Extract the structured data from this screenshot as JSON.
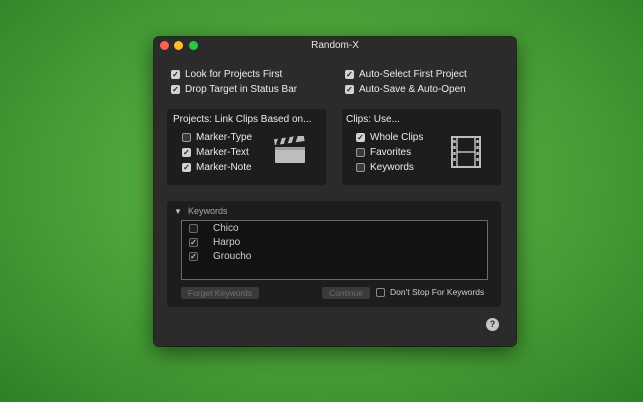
{
  "window": {
    "title": "Random-X"
  },
  "options": {
    "look_for_projects_first": {
      "label": "Look for Projects First",
      "checked": true
    },
    "drop_target_status_bar": {
      "label": "Drop Target in Status Bar",
      "checked": true
    },
    "auto_select_first_project": {
      "label": "Auto-Select First Project",
      "checked": true
    },
    "auto_save_auto_open": {
      "label": "Auto-Save & Auto-Open",
      "checked": true
    }
  },
  "projects_panel": {
    "title": "Projects: Link Clips Based on...",
    "items": [
      {
        "label": "Marker-Type",
        "checked": false
      },
      {
        "label": "Marker-Text",
        "checked": true
      },
      {
        "label": "Marker-Note",
        "checked": true
      }
    ],
    "icon": "clapperboard-icon"
  },
  "clips_panel": {
    "title": "Clips: Use...",
    "items": [
      {
        "label": "Whole Clips",
        "checked": true
      },
      {
        "label": "Favorites",
        "checked": false
      },
      {
        "label": "Keywords",
        "checked": false
      }
    ],
    "icon": "film-strip-icon"
  },
  "keywords_panel": {
    "label": "Keywords",
    "expanded": true,
    "items": [
      {
        "label": "Chico",
        "checked": false
      },
      {
        "label": "Harpo",
        "checked": true
      },
      {
        "label": "Groucho",
        "checked": true
      }
    ],
    "forget_button": "Forget Keywords",
    "continue_button": "Continue",
    "dont_stop": {
      "label": "Don't Stop For Keywords",
      "checked": false
    }
  },
  "help": {
    "label": "?"
  },
  "check_glyph": "✓"
}
